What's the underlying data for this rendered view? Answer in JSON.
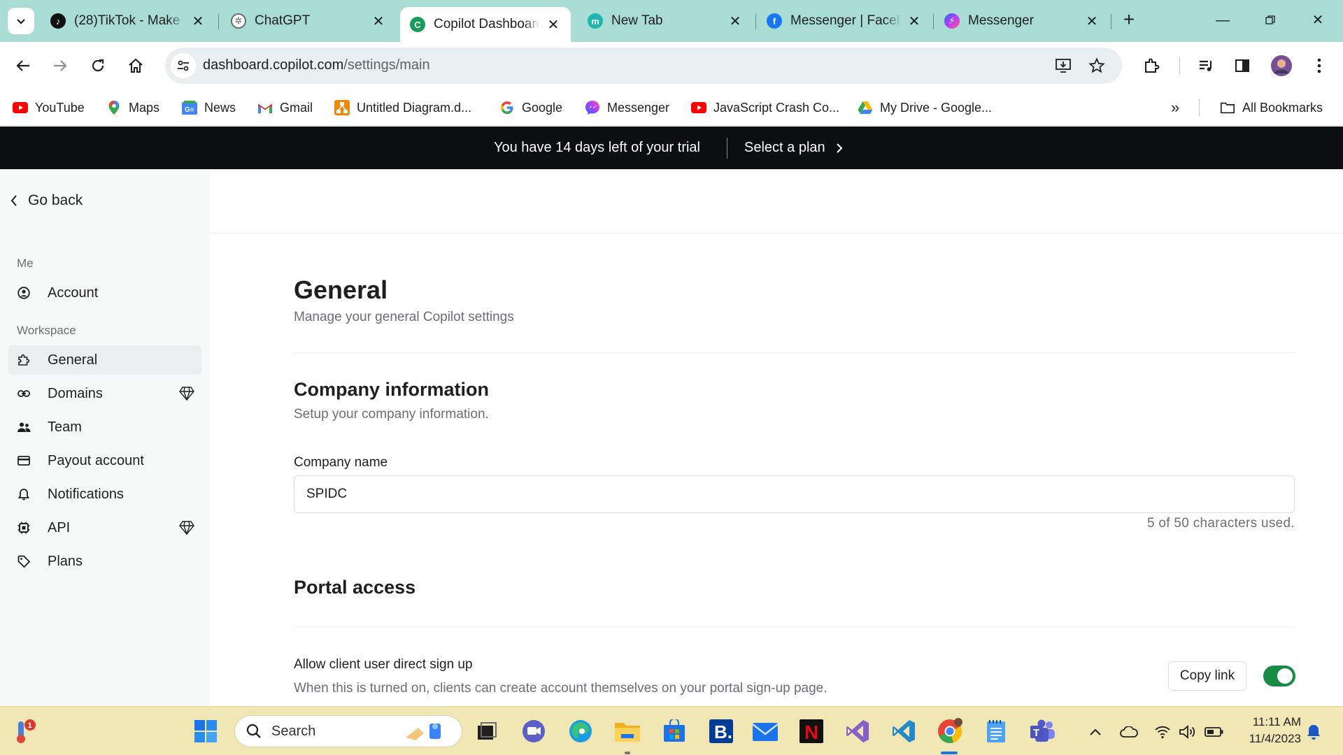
{
  "browser": {
    "tabs": [
      {
        "title": "(28)TikTok - Make",
        "favicon": "tiktok-icon"
      },
      {
        "title": "ChatGPT",
        "favicon": "chatgpt-icon"
      },
      {
        "title": "Copilot Dashboard",
        "favicon": "copilot-icon",
        "active": true
      },
      {
        "title": "New Tab",
        "favicon": "new-tab-favicon-icon"
      },
      {
        "title": "Messenger | Faceb",
        "favicon": "facebook-icon"
      },
      {
        "title": "Messenger",
        "favicon": "messenger-icon"
      }
    ],
    "url_host": "dashboard.copilot.com",
    "url_path": "/settings/main",
    "bookmarks": [
      {
        "label": "YouTube",
        "icon": "youtube-icon"
      },
      {
        "label": "Maps",
        "icon": "maps-icon"
      },
      {
        "label": "News",
        "icon": "news-icon"
      },
      {
        "label": "Gmail",
        "icon": "gmail-icon"
      },
      {
        "label": "Untitled Diagram.d...",
        "icon": "drawio-icon"
      },
      {
        "label": "Google",
        "icon": "google-icon"
      },
      {
        "label": "Messenger",
        "icon": "messenger-icon"
      },
      {
        "label": "JavaScript Crash Co...",
        "icon": "youtube-icon"
      },
      {
        "label": "My Drive - Google...",
        "icon": "drive-icon"
      }
    ],
    "all_bookmarks": "All Bookmarks",
    "overflow": "»"
  },
  "banner": {
    "trial_text": "You have 14 days left of your trial",
    "plan_label": "Select a plan"
  },
  "sidebar": {
    "go_back": "Go back",
    "sections": [
      {
        "label": "Me",
        "items": [
          {
            "label": "Account",
            "icon": "account-icon"
          }
        ]
      },
      {
        "label": "Workspace",
        "items": [
          {
            "label": "General",
            "icon": "puzzle-icon",
            "active": true
          },
          {
            "label": "Domains",
            "icon": "link-icon",
            "premium": true
          },
          {
            "label": "Team",
            "icon": "team-icon"
          },
          {
            "label": "Payout account",
            "icon": "card-icon"
          },
          {
            "label": "Notifications",
            "icon": "bell-icon"
          },
          {
            "label": "API",
            "icon": "chip-icon",
            "premium": true
          },
          {
            "label": "Plans",
            "icon": "tag-icon"
          }
        ]
      }
    ]
  },
  "main": {
    "title": "General",
    "subtitle": "Manage your general Copilot settings",
    "company": {
      "title": "Company information",
      "subtitle": "Setup your company information.",
      "name_label": "Company name",
      "name_value": "SPIDC",
      "char_count": "5 of 50 characters used."
    },
    "portal": {
      "title": "Portal access",
      "signup_label": "Allow client user direct sign up",
      "signup_desc": "When this is turned on, clients can create account themselves on your portal sign-up page.",
      "copy_link": "Copy link",
      "signup_enabled": true
    }
  },
  "taskbar": {
    "search_placeholder": "Search",
    "time": "11:11 AM",
    "date": "11/4/2023",
    "badge": "1"
  },
  "colors": {
    "tabstrip": "#a8dcd4",
    "banner": "#0b0f0f",
    "toggle_on": "#1a8a47",
    "taskbar": "#f1e7b4"
  }
}
